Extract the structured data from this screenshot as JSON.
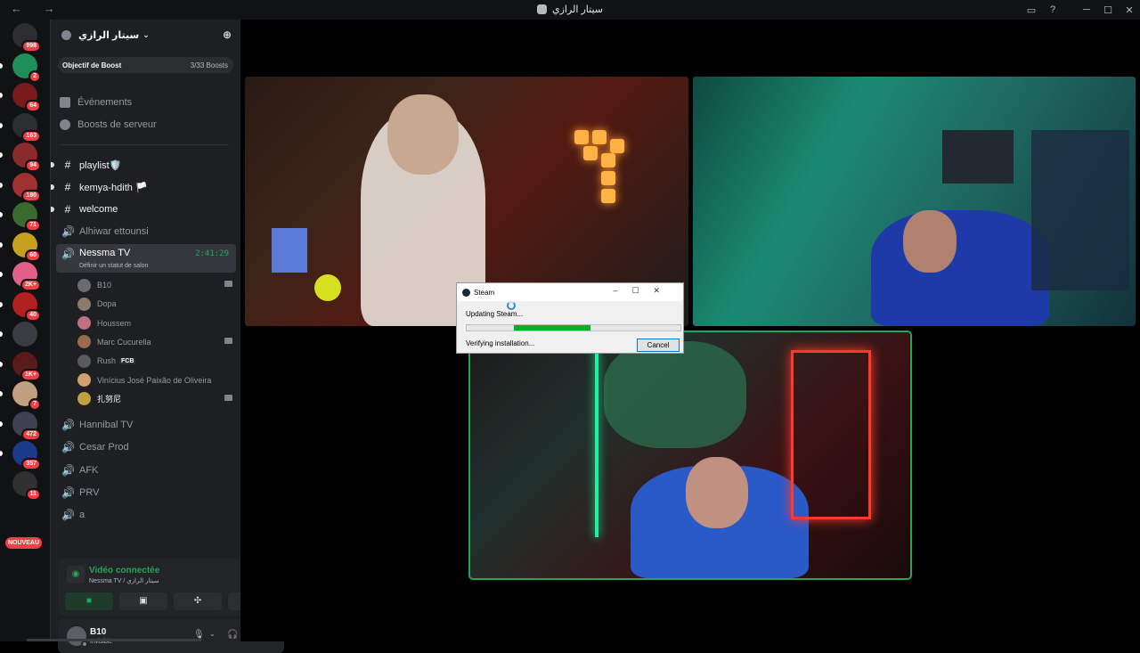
{
  "window": {
    "nav": "← →",
    "title": "سيتار الرازي",
    "controls": [
      "▭",
      "?",
      "─",
      "☐",
      "✕"
    ]
  },
  "servers": [
    {
      "badge": "998",
      "color": "#2b2d31"
    },
    {
      "badge": "2",
      "color": "#1f8f5a"
    },
    {
      "badge": "64",
      "color": "#7a1a1a"
    },
    {
      "badge": "163",
      "color": "#2b2d31"
    },
    {
      "badge": "94",
      "color": "#8a2a2a"
    },
    {
      "badge": "180",
      "color": "#a03030"
    },
    {
      "badge": "71",
      "color": "#3a6a30"
    },
    {
      "badge": "60",
      "color": "#c8a020"
    },
    {
      "badge": "2K+",
      "color": "#e0608a"
    },
    {
      "badge": "40",
      "color": "#b02020"
    },
    {
      "badge": "",
      "color": "#3a3c42"
    },
    {
      "badge": "1K+",
      "color": "#5a1a1a"
    },
    {
      "badge": "7",
      "color": "#c0a080"
    },
    {
      "badge": "472",
      "color": "#404050"
    },
    {
      "badge": "357",
      "color": "#1a3a8a"
    },
    {
      "badge": "11",
      "color": "#303030"
    }
  ],
  "nouveau": "NOUVEAU",
  "sidebar": {
    "guild_name": "سيتار الرازي",
    "boost_label": "Objectif de Boost",
    "boost_count": "3/33 Boosts",
    "events": "Événements",
    "server_boosts": "Boosts de serveur",
    "channels": [
      {
        "name": "playlist🛡️",
        "type": "text",
        "bright": true
      },
      {
        "name": "kemya-hdith 🏳️",
        "type": "text",
        "bright": true
      },
      {
        "name": "welcome",
        "type": "text",
        "bright": true
      },
      {
        "name": "Alhiwar ettounsi",
        "type": "voice",
        "bright": false
      }
    ],
    "active_channel": {
      "name": "Nessma TV",
      "timer": "2:41:29",
      "status_hint": "Définir un statut de salon"
    },
    "members": [
      {
        "name": "B10",
        "cam": true,
        "color": "#6a6c72",
        "tag": ""
      },
      {
        "name": "Dopa",
        "cam": false,
        "color": "#8a7a6a",
        "tag": ""
      },
      {
        "name": "Houssem",
        "cam": false,
        "color": "#c07080",
        "tag": ""
      },
      {
        "name": "Marc Cucurella",
        "cam": true,
        "color": "#9a6a4a",
        "tag": ""
      },
      {
        "name": "Rush",
        "cam": false,
        "color": "#5a5a5a",
        "tag": "FCB"
      },
      {
        "name": "Vinícius José Paixão de Oliveira",
        "cam": false,
        "color": "#d0a070",
        "tag": ""
      },
      {
        "name": "扎努尼",
        "cam": true,
        "color": "#c0a040",
        "tag": ""
      }
    ],
    "more_channels": [
      "Hannibal TV",
      "Cesar Prod",
      "AFK",
      "PRV",
      "a"
    ]
  },
  "voice": {
    "status": "Vidéo connectée",
    "location": "Nessma TV / سيتار الرازي"
  },
  "user": {
    "name": "B10",
    "status": "Invisible"
  },
  "steam": {
    "title": "Steam",
    "updating": "Updating Steam...",
    "verifying": "Verifying installation...",
    "cancel": "Cancel",
    "progress": 0.36
  }
}
